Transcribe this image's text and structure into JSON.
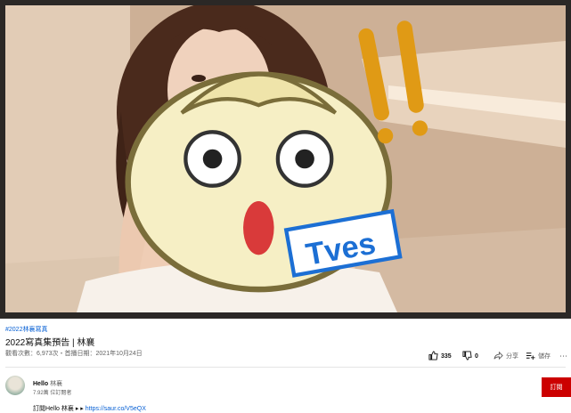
{
  "video": {
    "sticker_text": "Tves"
  },
  "hashtag": "#2022林襄寫真",
  "title": "2022寫真集預告 | 林襄",
  "meta": "觀看次數：6,973次・首播日期：2021年10月24日",
  "actions": {
    "like_count": "335",
    "dislike_count": "0",
    "share_label": "分享",
    "save_label": "儲存",
    "more_label": "⋯"
  },
  "channel": {
    "name": "Hello",
    "name_suffix": "林襄",
    "subscribers": "7.92萬 位訂閱者",
    "subscribe_label": "訂閱"
  },
  "description": {
    "prefix": "訂閱Hello 林襄 ▸ ▸",
    "link": "https://saur.co/V5eQX"
  },
  "colors": {
    "accent_red": "#cc0000",
    "link_blue": "#065fd4"
  }
}
